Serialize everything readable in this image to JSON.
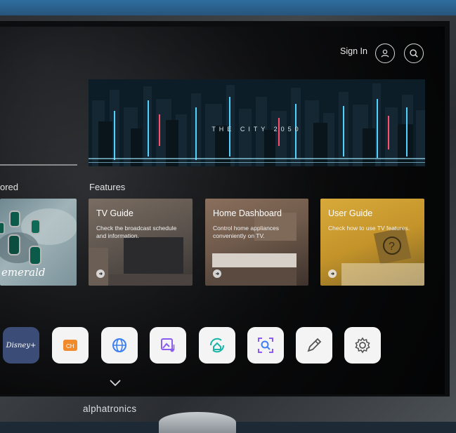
{
  "header": {
    "sign_in_label": "Sign In"
  },
  "hero": {
    "text": "THE CITY 2050"
  },
  "sections": {
    "explored_title": "ored",
    "features_title": "Features"
  },
  "cards": {
    "emerald": {
      "text": "emerald"
    },
    "tv_guide": {
      "title": "TV Guide",
      "description": "Check the broadcast schedule and information."
    },
    "home_dashboard": {
      "title": "Home Dashboard",
      "description": "Control home appliances conveniently on TV."
    },
    "user_guide": {
      "title": "User Guide",
      "description": "Check how to use TV features."
    }
  },
  "apps": {
    "disney_label": "Disney+",
    "ch_label": "CH"
  },
  "brand": {
    "name": "alphatronics"
  },
  "icons": [
    "profile-icon",
    "search-icon",
    "arrow-right-icon",
    "globe-icon",
    "gallery-music-icon",
    "home-sync-icon",
    "lens-search-icon",
    "pencil-icon",
    "gear-icon",
    "chevron-down-icon"
  ],
  "colors": {
    "accent_orange": "#f08a2a",
    "accent_purple": "#8a5cf0",
    "accent_teal": "#19b5a8",
    "accent_blue": "#3d7ff0"
  }
}
